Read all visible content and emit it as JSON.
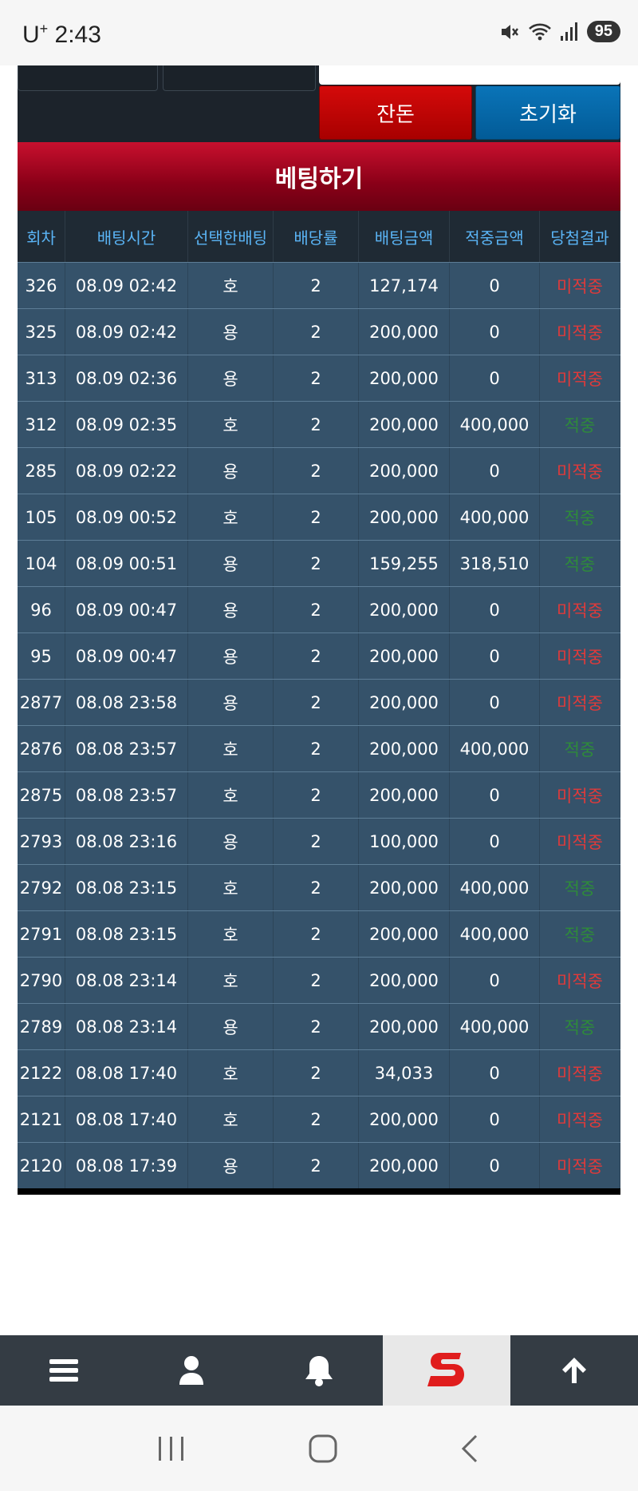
{
  "status": {
    "carrier": "U",
    "carrier_sup": "+",
    "time": "2:43",
    "battery": "95"
  },
  "actions": {
    "left_button": "잔돈",
    "right_button": "초기화"
  },
  "banner": {
    "title": "베팅하기"
  },
  "table": {
    "headers": [
      "회차",
      "배팅시간",
      "선택한배팅",
      "배당률",
      "배팅금액",
      "적중금액",
      "당첨결과"
    ],
    "rows": [
      {
        "round": "326",
        "time": "08.09 02:42",
        "pick": "호",
        "odds": "2",
        "amount": "127,174",
        "win": "0",
        "result": "미적중"
      },
      {
        "round": "325",
        "time": "08.09 02:42",
        "pick": "용",
        "odds": "2",
        "amount": "200,000",
        "win": "0",
        "result": "미적중"
      },
      {
        "round": "313",
        "time": "08.09 02:36",
        "pick": "용",
        "odds": "2",
        "amount": "200,000",
        "win": "0",
        "result": "미적중"
      },
      {
        "round": "312",
        "time": "08.09 02:35",
        "pick": "호",
        "odds": "2",
        "amount": "200,000",
        "win": "400,000",
        "result": "적중"
      },
      {
        "round": "285",
        "time": "08.09 02:22",
        "pick": "용",
        "odds": "2",
        "amount": "200,000",
        "win": "0",
        "result": "미적중"
      },
      {
        "round": "105",
        "time": "08.09 00:52",
        "pick": "호",
        "odds": "2",
        "amount": "200,000",
        "win": "400,000",
        "result": "적중"
      },
      {
        "round": "104",
        "time": "08.09 00:51",
        "pick": "용",
        "odds": "2",
        "amount": "159,255",
        "win": "318,510",
        "result": "적중"
      },
      {
        "round": "96",
        "time": "08.09 00:47",
        "pick": "용",
        "odds": "2",
        "amount": "200,000",
        "win": "0",
        "result": "미적중"
      },
      {
        "round": "95",
        "time": "08.09 00:47",
        "pick": "용",
        "odds": "2",
        "amount": "200,000",
        "win": "0",
        "result": "미적중"
      },
      {
        "round": "2877",
        "time": "08.08 23:58",
        "pick": "용",
        "odds": "2",
        "amount": "200,000",
        "win": "0",
        "result": "미적중"
      },
      {
        "round": "2876",
        "time": "08.08 23:57",
        "pick": "호",
        "odds": "2",
        "amount": "200,000",
        "win": "400,000",
        "result": "적중"
      },
      {
        "round": "2875",
        "time": "08.08 23:57",
        "pick": "호",
        "odds": "2",
        "amount": "200,000",
        "win": "0",
        "result": "미적중"
      },
      {
        "round": "2793",
        "time": "08.08 23:16",
        "pick": "용",
        "odds": "2",
        "amount": "100,000",
        "win": "0",
        "result": "미적중"
      },
      {
        "round": "2792",
        "time": "08.08 23:15",
        "pick": "호",
        "odds": "2",
        "amount": "200,000",
        "win": "400,000",
        "result": "적중"
      },
      {
        "round": "2791",
        "time": "08.08 23:15",
        "pick": "호",
        "odds": "2",
        "amount": "200,000",
        "win": "400,000",
        "result": "적중"
      },
      {
        "round": "2790",
        "time": "08.08 23:14",
        "pick": "호",
        "odds": "2",
        "amount": "200,000",
        "win": "0",
        "result": "미적중"
      },
      {
        "round": "2789",
        "time": "08.08 23:14",
        "pick": "용",
        "odds": "2",
        "amount": "200,000",
        "win": "400,000",
        "result": "적중"
      },
      {
        "round": "2122",
        "time": "08.08 17:40",
        "pick": "호",
        "odds": "2",
        "amount": "34,033",
        "win": "0",
        "result": "미적중"
      },
      {
        "round": "2121",
        "time": "08.08 17:40",
        "pick": "호",
        "odds": "2",
        "amount": "200,000",
        "win": "0",
        "result": "미적중"
      },
      {
        "round": "2120",
        "time": "08.08 17:39",
        "pick": "용",
        "odds": "2",
        "amount": "200,000",
        "win": "0",
        "result": "미적중"
      }
    ]
  },
  "bottom_nav": [
    {
      "icon": "menu-icon"
    },
    {
      "icon": "user-icon"
    },
    {
      "icon": "bell-icon"
    },
    {
      "icon": "logo-s-icon",
      "active": true
    },
    {
      "icon": "arrow-up-icon"
    }
  ],
  "colors": {
    "miss": "#e03a3a",
    "hit": "#2e8b3a",
    "header_text": "#5ab4f5",
    "row_bg": "#35526a",
    "banner": "#8a0018"
  }
}
